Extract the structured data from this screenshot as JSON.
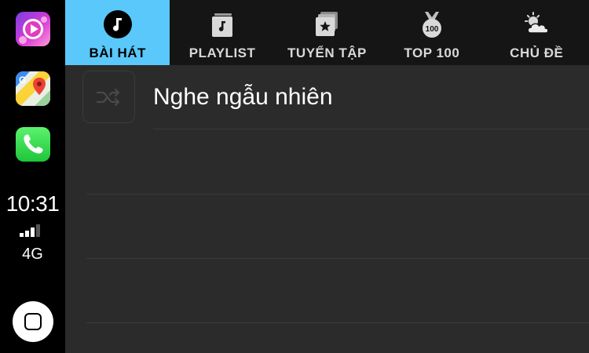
{
  "dock": {
    "apps": [
      {
        "name": "music-app",
        "icon": "music-player-icon"
      },
      {
        "name": "maps-app",
        "icon": "google-maps-icon"
      },
      {
        "name": "phone-app",
        "icon": "phone-icon"
      }
    ],
    "status": {
      "time": "10:31",
      "network": "4G",
      "signal_bars": 3
    }
  },
  "tabs": [
    {
      "label": "BÀI HÁT",
      "icon": "music-note-icon",
      "active": true
    },
    {
      "label": "PLAYLIST",
      "icon": "playlist-icon",
      "active": false
    },
    {
      "label": "TUYỂN TẬP",
      "icon": "collection-star-icon",
      "active": false
    },
    {
      "label": "TOP 100",
      "icon": "top100-badge-icon",
      "active": false
    },
    {
      "label": "CHỦ ĐỀ",
      "icon": "weather-topic-icon",
      "active": false
    }
  ],
  "content": {
    "shuffle_label": "Nghe ngẫu nhiên",
    "shuffle_icon": "shuffle-icon"
  },
  "colors": {
    "active_tab": "#5ac8fa",
    "tabbar_bg": "#151515",
    "content_bg": "#2b2b2b"
  }
}
